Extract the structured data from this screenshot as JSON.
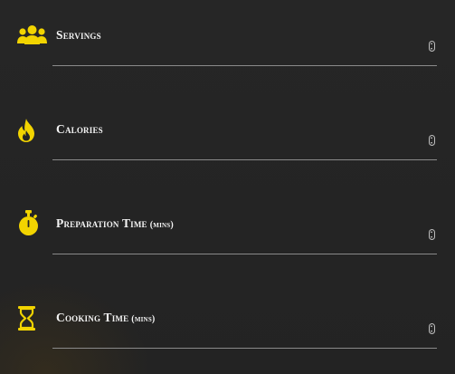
{
  "accent_color": "#f2d400",
  "fields": [
    {
      "id": "servings",
      "icon": "users-icon",
      "label": "Servings",
      "unit": "",
      "value": ""
    },
    {
      "id": "calories",
      "icon": "flame-icon",
      "label": "Calories",
      "unit": "",
      "value": ""
    },
    {
      "id": "preparation-time",
      "icon": "stopwatch-icon",
      "label": "Preparation Time",
      "unit": "(mins)",
      "value": ""
    },
    {
      "id": "cooking-time",
      "icon": "hourglass-icon",
      "label": "Cooking Time",
      "unit": "(mins)",
      "value": ""
    }
  ]
}
